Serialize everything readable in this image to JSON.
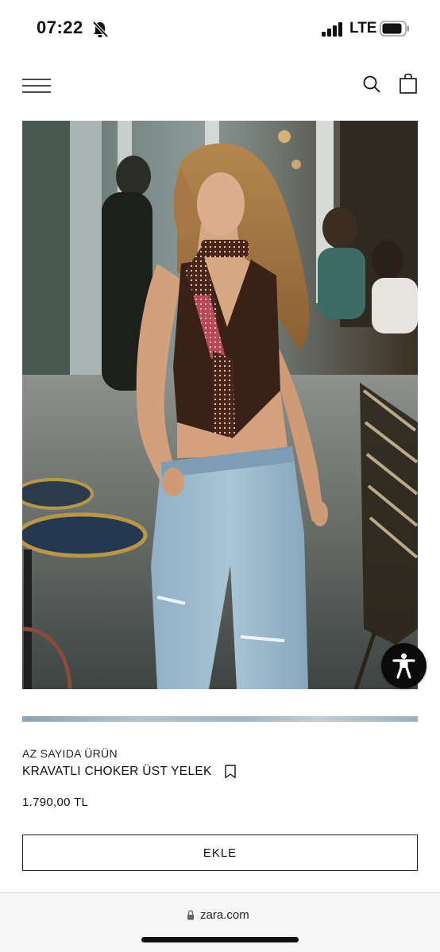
{
  "status_bar": {
    "time": "07:22",
    "network": "LTE",
    "icons": [
      "bell-slash-icon",
      "signal-icon",
      "battery-icon"
    ]
  },
  "nav": {
    "icons": [
      "menu-icon",
      "search-icon",
      "shopping-bag-icon"
    ]
  },
  "product": {
    "stock_label": "AZ SAYIDA ÜRÜN",
    "name": "KRAVATLI CHOKER ÜST YELEK",
    "price": "1.790,00 TL",
    "add_button_label": "EKLE",
    "bookmark_icon": "bookmark-icon",
    "image_alt": "Model wearing brown halter vest with polka-dot tie choker and light blue ripped jeans"
  },
  "accessibility": {
    "icon": "accessibility-icon"
  },
  "browser": {
    "url": "zara.com",
    "lock_icon": "lock-icon"
  },
  "colors": {
    "text": "#111111",
    "background": "#ffffff",
    "a11y_button": "#0b0b0b",
    "url_bar": "#f6f6f6"
  }
}
